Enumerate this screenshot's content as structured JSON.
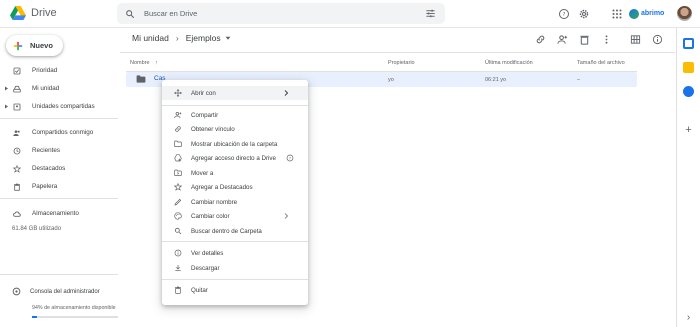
{
  "app": {
    "name": "Drive"
  },
  "search": {
    "placeholder": "Buscar en Drive"
  },
  "brand": {
    "text": "abrimo"
  },
  "sidebar": {
    "new_label": "Nuevo",
    "items": [
      {
        "label": "Prioridad",
        "icon": "checkbox-icon"
      },
      {
        "label": "Mi unidad",
        "icon": "drive-icon"
      },
      {
        "label": "Unidades compartidas",
        "icon": "shared-drives-icon"
      },
      {
        "label": "Compartidos conmigo",
        "icon": "people-icon"
      },
      {
        "label": "Recientes",
        "icon": "clock-icon"
      },
      {
        "label": "Destacados",
        "icon": "star-icon"
      },
      {
        "label": "Papelera",
        "icon": "trash-icon"
      },
      {
        "label": "Almacenamiento",
        "icon": "cloud-icon"
      }
    ],
    "storage_used": "61.84 GB utilizado",
    "admin_label": "Consola del administrador",
    "available_label": "94% de almacenamiento disponible",
    "available_percent": 6
  },
  "breadcrumb": {
    "root": "Mi unidad",
    "separator": "›",
    "current": "Ejemplos"
  },
  "table": {
    "headers": {
      "name": "Nombre",
      "owner": "Propietario",
      "modified": "Última modificación",
      "size": "Tamaño del archivo"
    },
    "rows": [
      {
        "name": "Cas",
        "owner": "yo",
        "modified": "06:21  yo",
        "size": "–"
      }
    ]
  },
  "context_menu": {
    "items": [
      {
        "label": "Abrir con",
        "icon": "open-with-icon"
      },
      {
        "label": "Compartir",
        "icon": "person-add-icon"
      },
      {
        "label": "Obtener vínculo",
        "icon": "link-icon"
      },
      {
        "label": "Mostrar ubicación de la carpeta",
        "icon": "folder-icon"
      },
      {
        "label": "Agregar acceso directo a Drive",
        "icon": "shortcut-icon"
      },
      {
        "label": "Mover a",
        "icon": "move-icon"
      },
      {
        "label": "Agregar a Destacados",
        "icon": "star-icon"
      },
      {
        "label": "Cambiar nombre",
        "icon": "pencil-icon"
      },
      {
        "label": "Cambiar color",
        "icon": "palette-icon"
      },
      {
        "label": "Buscar dentro de Carpeta",
        "icon": "search-icon"
      },
      {
        "label": "Ver detalles",
        "icon": "info-icon"
      },
      {
        "label": "Descargar",
        "icon": "download-icon"
      },
      {
        "label": "Quitar",
        "icon": "trash-icon"
      }
    ]
  },
  "colors": {
    "accent": "#1a73e8",
    "selected_row": "#e8f0fe",
    "menu_hover": "#f1f3f4"
  }
}
